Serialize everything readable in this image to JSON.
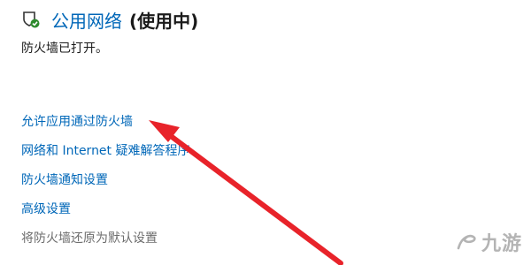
{
  "network": {
    "name": "公用网络",
    "state": "(使用中)",
    "status": "防火墙已打开。"
  },
  "links": [
    {
      "label": "允许应用通过防火墙",
      "enabled": true
    },
    {
      "label": "网络和 Internet 疑难解答程序",
      "enabled": true
    },
    {
      "label": "防火墙通知设置",
      "enabled": true
    },
    {
      "label": "高级设置",
      "enabled": true
    },
    {
      "label": "将防火墙还原为默认设置",
      "enabled": false
    }
  ],
  "watermark": {
    "text": "九游"
  },
  "colors": {
    "link": "#0067b8",
    "disabled": "#6d6d6d",
    "arrow": "#e8232a",
    "shield_badge": "#2e8b2e"
  },
  "icons": {
    "network": "shield-network-icon",
    "annotation": "red-arrow"
  }
}
